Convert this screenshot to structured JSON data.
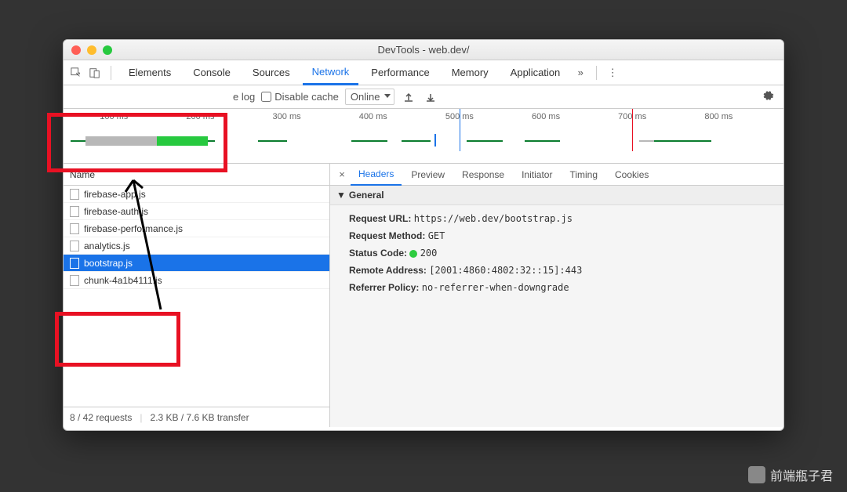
{
  "title": "DevTools - web.dev/",
  "tabs": [
    "Elements",
    "Console",
    "Sources",
    "Network",
    "Performance",
    "Memory",
    "Application"
  ],
  "activeTab": "Network",
  "toolbar": {
    "preserve_log": "e log",
    "disable_cache": "Disable cache",
    "throttle": "Online"
  },
  "timeline": {
    "ticks": [
      "100 ms",
      "200 ms",
      "300 ms",
      "400 ms",
      "500 ms",
      "600 ms",
      "700 ms",
      "800 ms"
    ]
  },
  "requests_header": "Name",
  "requests": [
    {
      "name": "firebase-app.js",
      "selected": false
    },
    {
      "name": "firebase-auth.js",
      "selected": false
    },
    {
      "name": "firebase-performance.js",
      "selected": false
    },
    {
      "name": "analytics.js",
      "selected": false
    },
    {
      "name": "bootstrap.js",
      "selected": true
    },
    {
      "name": "chunk-4a1b4111.js",
      "selected": false
    }
  ],
  "status_bar": {
    "requests": "8 / 42 requests",
    "transfer": "2.3 KB / 7.6 KB transfer"
  },
  "detail_tabs": [
    "Headers",
    "Preview",
    "Response",
    "Initiator",
    "Timing",
    "Cookies"
  ],
  "active_detail_tab": "Headers",
  "headers": {
    "section": "General",
    "items": [
      {
        "k": "Request URL:",
        "v": "https://web.dev/bootstrap.js"
      },
      {
        "k": "Request Method:",
        "v": "GET"
      },
      {
        "k": "Status Code:",
        "v": "200",
        "status": true
      },
      {
        "k": "Remote Address:",
        "v": "[2001:4860:4802:32::15]:443"
      },
      {
        "k": "Referrer Policy:",
        "v": "no-referrer-when-downgrade"
      }
    ]
  },
  "watermark": "前端瓶子君"
}
